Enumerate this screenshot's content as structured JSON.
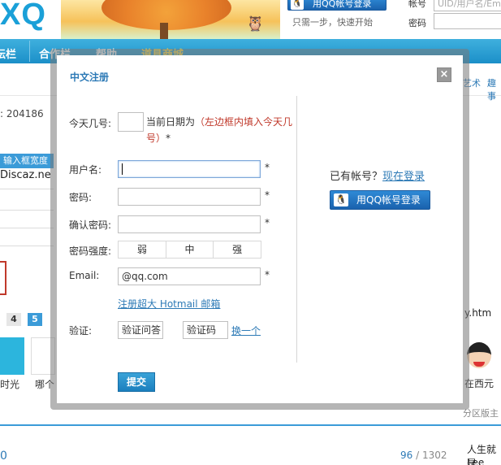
{
  "background": {
    "logo": "XQ",
    "top_qq_login": "用QQ帐号登录",
    "top_hint": "只需一步，快速开始",
    "account_label": "帐号",
    "account_placeholder": "UID/用户名/Em",
    "password_label": "密码",
    "nav": [
      "坛栏",
      "合作栏",
      "帮助",
      "道具商城"
    ],
    "sub_right_1": "艺术",
    "sub_right_2": "趣事",
    "member_count": ": 204186",
    "strip_text": "输入框宽度",
    "discaz_text": "Discaz.ne",
    "pager": [
      "4",
      "5"
    ],
    "tile_caption_1": "时光",
    "tile_caption_2": "哪个",
    "right_fragment": "y.htm",
    "right_caption": "在西元",
    "right_mod": "分区版主",
    "page_current": "96",
    "page_sep": " / ",
    "page_total": "1302",
    "life_text": "人生就是",
    "lee_text": "Lee",
    "zero_text": "0"
  },
  "dialog": {
    "title": "中文注册",
    "close_label": "×",
    "day_label": "今天几号:",
    "day_value": "",
    "date_hint_prefix": "当前日期为",
    "date_hint_red": "（左边框内填入今天几号）",
    "date_hint_suffix": "*",
    "username_label": "用户名:",
    "username_value": "",
    "password_label": "密码:",
    "password_value": "",
    "confirm_label": "确认密码:",
    "confirm_value": "",
    "strength_label": "密码强度:",
    "strength_levels": [
      "弱",
      "中",
      "强"
    ],
    "email_label": "Email:",
    "email_value": "@qq.com",
    "hotmail_link": "注册超大 Hotmail 邮箱",
    "verify_label": "验证:",
    "verify_question": "验证问答",
    "verify_code": "验证码",
    "change_link": "换一个",
    "required_mark": "*",
    "submit_label": "提交",
    "have_account": "已有帐号？",
    "login_now": "现在登录",
    "qq_login": "用QQ帐号登录"
  },
  "colors": {
    "accent": "#2d7ab6",
    "nav_bg": "#1b8fc8",
    "warning_red": "#c0392b"
  },
  "icons": {
    "qq": "qq-penguin-icon",
    "close": "close-icon"
  }
}
